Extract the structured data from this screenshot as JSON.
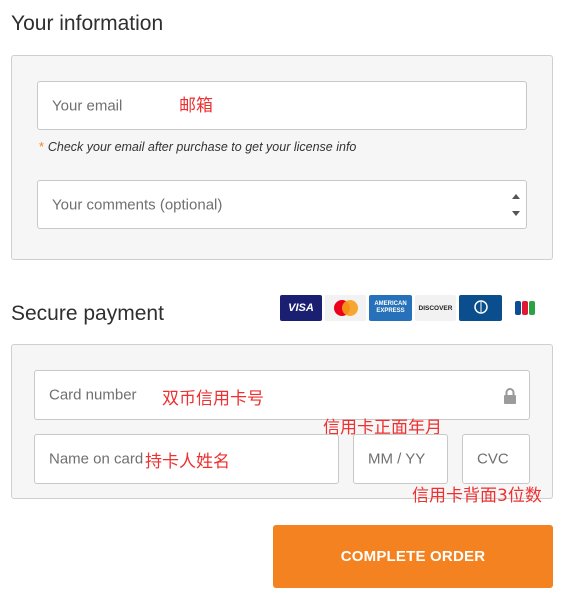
{
  "info_section": {
    "title": "Your information",
    "email": {
      "placeholder": "Your email",
      "annotation": "邮箱"
    },
    "hint": {
      "asterisk": "*",
      "text": "Check your email after purchase to get your license info"
    },
    "comments": {
      "placeholder": "Your comments (optional)"
    }
  },
  "payment_section": {
    "title": "Secure payment",
    "card_logos": [
      {
        "name": "visa-logo",
        "label": "VISA",
        "bg": "#1a1f71",
        "fg": "#ffffff"
      },
      {
        "name": "mastercard-logo",
        "label": "MasterCard",
        "bg": "#f2f2f2",
        "fg": "#222222"
      },
      {
        "name": "amex-logo",
        "label": "AMERICAN EXPRESS",
        "bg": "#2671b9",
        "fg": "#ffffff"
      },
      {
        "name": "discover-logo",
        "label": "DISCOVER",
        "bg": "#f2f2f2",
        "fg": "#222222"
      },
      {
        "name": "diners-club-logo",
        "label": "Diners Club",
        "bg": "#0a4e8e",
        "fg": "#ffffff"
      },
      {
        "name": "jcb-logo",
        "label": "JCB",
        "bg": "#ffffff",
        "fg": "#222222"
      }
    ],
    "card_number": {
      "placeholder": "Card number",
      "annotation": "双币信用卡号"
    },
    "expiry_annotation": "信用卡正面年月",
    "name_on_card": {
      "placeholder": "Name on card",
      "annotation": "持卡人姓名"
    },
    "expiry": {
      "placeholder": "MM / YY"
    },
    "cvc": {
      "placeholder": "CVC"
    },
    "cvc_annotation": "信用卡背面3位数"
  },
  "order_button": {
    "label": "COMPLETE ORDER"
  },
  "colors": {
    "accent": "#f58220",
    "annotation": "#ee3030",
    "panel_bg": "#f6f6f6"
  }
}
